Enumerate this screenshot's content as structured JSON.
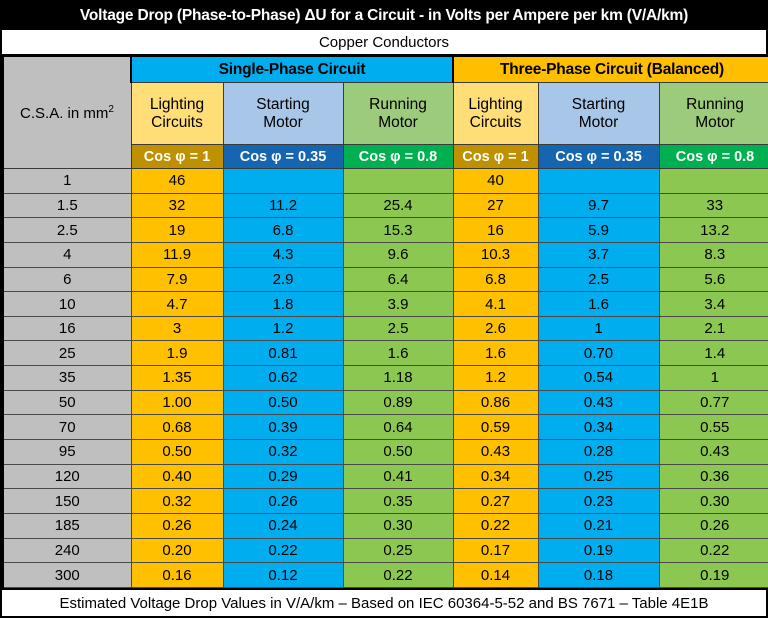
{
  "title": "Voltage Drop (Phase-to-Phase) ΔU for a Circuit - in Volts per Ampere per km (V/A/km)",
  "subtitle": "Copper Conductors",
  "footer": "Estimated Voltage Drop Values in V/A/km – Based on IEC 60364-5-52 and BS 7671 – Table 4E1B",
  "colors": {
    "title_bg": "#000000",
    "amber": "#FFC000",
    "blue": "#00AEEF",
    "green": "#8CC751",
    "grey": "#BFBFBF",
    "amber_dark": "#BF9000",
    "blue_dark": "#1565B0",
    "green_dark": "#00B050",
    "amber_light": "#FFDD77",
    "blue_light": "#A8C6E8",
    "green_light": "#9CCB7B",
    "group_three_phase": "#FFBF00",
    "group_single_phase": "#00AEEF"
  },
  "header": {
    "csa_label": "C.S.A. in mm",
    "csa_sup": "2",
    "groups": [
      {
        "label": "Single-Phase Circuit",
        "span": 3
      },
      {
        "label": "Three-Phase Circuit (Balanced)",
        "span": 3
      }
    ],
    "subcolumns": [
      {
        "line1": "Lighting",
        "line2": "Circuits"
      },
      {
        "line1": "Starting",
        "line2": "Motor"
      },
      {
        "line1": "Running",
        "line2": "Motor"
      },
      {
        "line1": "Lighting",
        "line2": "Circuits"
      },
      {
        "line1": "Starting",
        "line2": "Motor"
      },
      {
        "line1": "Running",
        "line2": "Motor"
      }
    ],
    "cos_phi": [
      "Cos φ = 1",
      "Cos φ = 0.35",
      "Cos φ = 0.8",
      "Cos φ = 1",
      "Cos φ = 0.35",
      "Cos φ = 0.8"
    ]
  },
  "chart_data": {
    "type": "table",
    "title": "Voltage Drop (Phase-to-Phase) ΔU for a Circuit - in Volts per Ampere per km (V/A/km)",
    "subtitle": "Copper Conductors",
    "xlabel": "C.S.A. in mm2",
    "ylabel": "Voltage Drop (V/A/km)",
    "categories": [
      "1",
      "1.5",
      "2.5",
      "4",
      "6",
      "10",
      "16",
      "25",
      "35",
      "50",
      "70",
      "95",
      "120",
      "150",
      "185",
      "240",
      "300"
    ],
    "series": [
      {
        "name": "Single-Phase / Lighting Circuits (Cos φ = 1)",
        "values": [
          "46",
          "32",
          "19",
          "11.9",
          "7.9",
          "4.7",
          "3",
          "1.9",
          "1.35",
          "1.00",
          "0.68",
          "0.50",
          "0.40",
          "0.32",
          "0.26",
          "0.20",
          "0.16"
        ]
      },
      {
        "name": "Single-Phase / Starting Motor (Cos φ = 0.35)",
        "values": [
          "",
          "11.2",
          "6.8",
          "4.3",
          "2.9",
          "1.8",
          "1.2",
          "0.81",
          "0.62",
          "0.50",
          "0.39",
          "0.32",
          "0.29",
          "0.26",
          "0.24",
          "0.22",
          "0.12"
        ]
      },
      {
        "name": "Single-Phase / Running Motor (Cos φ = 0.8)",
        "values": [
          "",
          "25.4",
          "15.3",
          "9.6",
          "6.4",
          "3.9",
          "2.5",
          "1.6",
          "1.18",
          "0.89",
          "0.64",
          "0.50",
          "0.41",
          "0.35",
          "0.30",
          "0.25",
          "0.22"
        ]
      },
      {
        "name": "Three-Phase / Lighting Circuits (Cos φ = 1)",
        "values": [
          "40",
          "27",
          "16",
          "10.3",
          "6.8",
          "4.1",
          "2.6",
          "1.6",
          "1.2",
          "0.86",
          "0.59",
          "0.43",
          "0.34",
          "0.27",
          "0.22",
          "0.17",
          "0.14"
        ]
      },
      {
        "name": "Three-Phase / Starting Motor (Cos φ = 0.35)",
        "values": [
          "",
          "9.7",
          "5.9",
          "3.7",
          "2.5",
          "1.6",
          "1",
          "0.70",
          "0.54",
          "0.43",
          "0.34",
          "0.28",
          "0.25",
          "0.23",
          "0.21",
          "0.19",
          "0.18"
        ]
      },
      {
        "name": "Three-Phase / Running Motor (Cos φ = 0.8)",
        "values": [
          "",
          "33",
          "13.2",
          "8.3",
          "5.6",
          "3.4",
          "2.1",
          "1.4",
          "1",
          "0.77",
          "0.55",
          "0.43",
          "0.36",
          "0.30",
          "0.26",
          "0.22",
          "0.19"
        ]
      }
    ]
  },
  "rows": [
    {
      "csa": "1",
      "cells": [
        "46",
        "",
        "",
        "40",
        "",
        ""
      ]
    },
    {
      "csa": "1.5",
      "cells": [
        "32",
        "11.2",
        "25.4",
        "27",
        "9.7",
        "33"
      ]
    },
    {
      "csa": "2.5",
      "cells": [
        "19",
        "6.8",
        "15.3",
        "16",
        "5.9",
        "13.2"
      ]
    },
    {
      "csa": "4",
      "cells": [
        "11.9",
        "4.3",
        "9.6",
        "10.3",
        "3.7",
        "8.3"
      ]
    },
    {
      "csa": "6",
      "cells": [
        "7.9",
        "2.9",
        "6.4",
        "6.8",
        "2.5",
        "5.6"
      ]
    },
    {
      "csa": "10",
      "cells": [
        "4.7",
        "1.8",
        "3.9",
        "4.1",
        "1.6",
        "3.4"
      ]
    },
    {
      "csa": "16",
      "cells": [
        "3",
        "1.2",
        "2.5",
        "2.6",
        "1",
        "2.1"
      ]
    },
    {
      "csa": "25",
      "cells": [
        "1.9",
        "0.81",
        "1.6",
        "1.6",
        "0.70",
        "1.4"
      ]
    },
    {
      "csa": "35",
      "cells": [
        "1.35",
        "0.62",
        "1.18",
        "1.2",
        "0.54",
        "1"
      ]
    },
    {
      "csa": "50",
      "cells": [
        "1.00",
        "0.50",
        "0.89",
        "0.86",
        "0.43",
        "0.77"
      ]
    },
    {
      "csa": "70",
      "cells": [
        "0.68",
        "0.39",
        "0.64",
        "0.59",
        "0.34",
        "0.55"
      ]
    },
    {
      "csa": "95",
      "cells": [
        "0.50",
        "0.32",
        "0.50",
        "0.43",
        "0.28",
        "0.43"
      ]
    },
    {
      "csa": "120",
      "cells": [
        "0.40",
        "0.29",
        "0.41",
        "0.34",
        "0.25",
        "0.36"
      ]
    },
    {
      "csa": "150",
      "cells": [
        "0.32",
        "0.26",
        "0.35",
        "0.27",
        "0.23",
        "0.30"
      ]
    },
    {
      "csa": "185",
      "cells": [
        "0.26",
        "0.24",
        "0.30",
        "0.22",
        "0.21",
        "0.26"
      ]
    },
    {
      "csa": "240",
      "cells": [
        "0.20",
        "0.22",
        "0.25",
        "0.17",
        "0.19",
        "0.22"
      ]
    },
    {
      "csa": "300",
      "cells": [
        "0.16",
        "0.12",
        "0.22",
        "0.14",
        "0.18",
        "0.19"
      ]
    }
  ]
}
